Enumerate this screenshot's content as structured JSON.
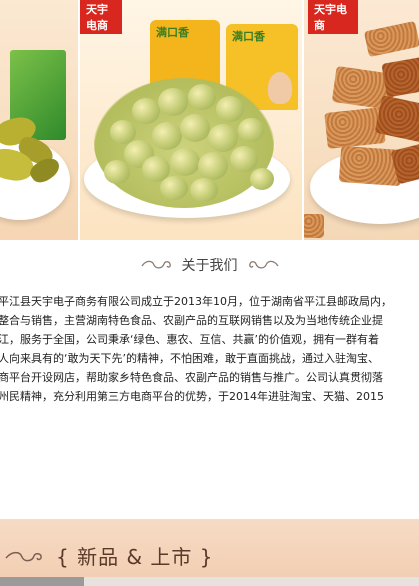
{
  "carousel": {
    "slides": [
      {
        "brand_tag": ""
      },
      {
        "brand_tag": "天宇电商",
        "bag_left_title": "满口香",
        "bag_right_title": "满口香"
      },
      {
        "brand_tag": "天宇电商"
      }
    ]
  },
  "about": {
    "heading": "关于我们",
    "lines": [
      "平江县天宇电子商务有限公司成立于2013年10月，位于湖南省平江县邮政局内，",
      "整合与销售，主营湖南特色食品、农副产品的互联网销售以及为当地传统企业提",
      "江，服务于全国，公司秉承‘绿色、惠农、互信、共赢’的价值观，拥有一群有着",
      "人向来具有的‘敢为天下先’的精神，不怕困难，敢于直面挑战，通过入驻淘宝、",
      "商平台开设网店，帮助家乡特色食品、农副产品的销售与推广。公司认真贯彻落",
      "州民精神，充分利用第三方电商平台的优势，于2014年进驻淘宝、天猫、2015"
    ]
  },
  "new_products": {
    "title": "{ 新品 & 上市 }"
  },
  "colors": {
    "brand_red": "#d8271e",
    "bar_bg": "#f1cdb1",
    "text": "#222222"
  },
  "icons": [
    "swirl-ornament-left-icon",
    "swirl-ornament-right-icon"
  ]
}
